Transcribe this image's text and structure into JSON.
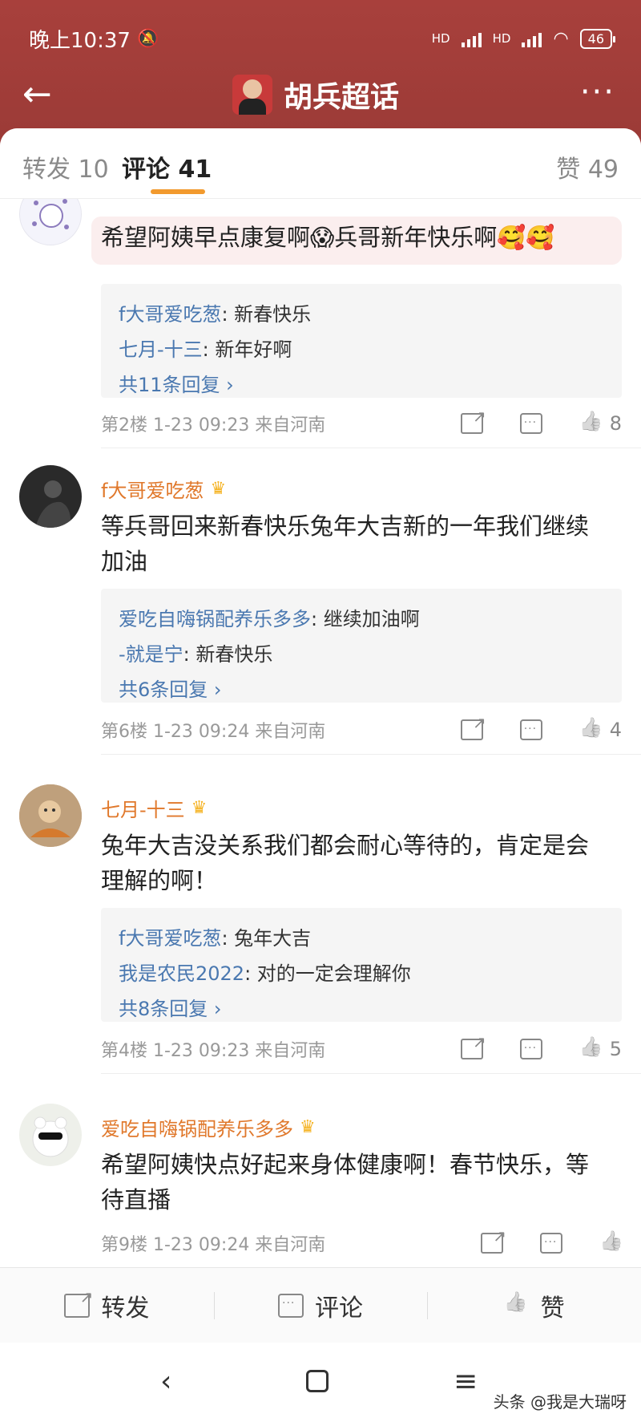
{
  "status": {
    "time": "晚上10:37",
    "battery": "46",
    "network": "HD"
  },
  "header": {
    "title": "胡兵超话"
  },
  "tabs": [
    {
      "label": "转发 10"
    },
    {
      "label": "评论 41"
    },
    {
      "label": "赞 49"
    }
  ],
  "comments": [
    {
      "name": "",
      "text": "希望阿姨早点康复啊😱兵哥新年快乐啊🥰🥰",
      "replies": [
        {
          "name": "f大哥爱吃葱",
          "text": ": 新春快乐"
        },
        {
          "name": "七月-十三",
          "text": ": 新年好啊"
        }
      ],
      "more": "共11条回复 ›",
      "meta": "第2楼  1-23 09:23  来自河南",
      "likes": "8"
    },
    {
      "name": "f大哥爱吃葱",
      "text": "等兵哥回来新春快乐兔年大吉新的一年我们继续加油",
      "replies": [
        {
          "name": "爱吃自嗨锅配养乐多多",
          "text": ": 继续加油啊"
        },
        {
          "name": "-就是宁",
          "text": ": 新春快乐"
        }
      ],
      "more": "共6条回复 ›",
      "meta": "第6楼  1-23 09:24  来自河南",
      "likes": "4"
    },
    {
      "name": "七月-十三",
      "text": "兔年大吉没关系我们都会耐心等待的，肯定是会理解的啊！",
      "replies": [
        {
          "name": "f大哥爱吃葱",
          "text": ": 兔年大吉"
        },
        {
          "name": "我是农民2022",
          "text": ": 对的一定会理解你"
        }
      ],
      "more": "共8条回复 ›",
      "meta": "第4楼  1-23 09:23  来自河南",
      "likes": "5"
    },
    {
      "name": "爱吃自嗨锅配养乐多多",
      "text": "希望阿姨快点好起来身体健康啊！春节快乐，等待直播",
      "meta": "第9楼  1-23 09:24  来自河南"
    }
  ],
  "actions": {
    "repost": "转发",
    "comment": "评论",
    "like": "赞"
  },
  "watermark": "头条 @我是大瑞呀",
  "colors": {
    "header_bg": "#a8403c",
    "accent": "#f29a2e",
    "link": "#4a78b0"
  }
}
